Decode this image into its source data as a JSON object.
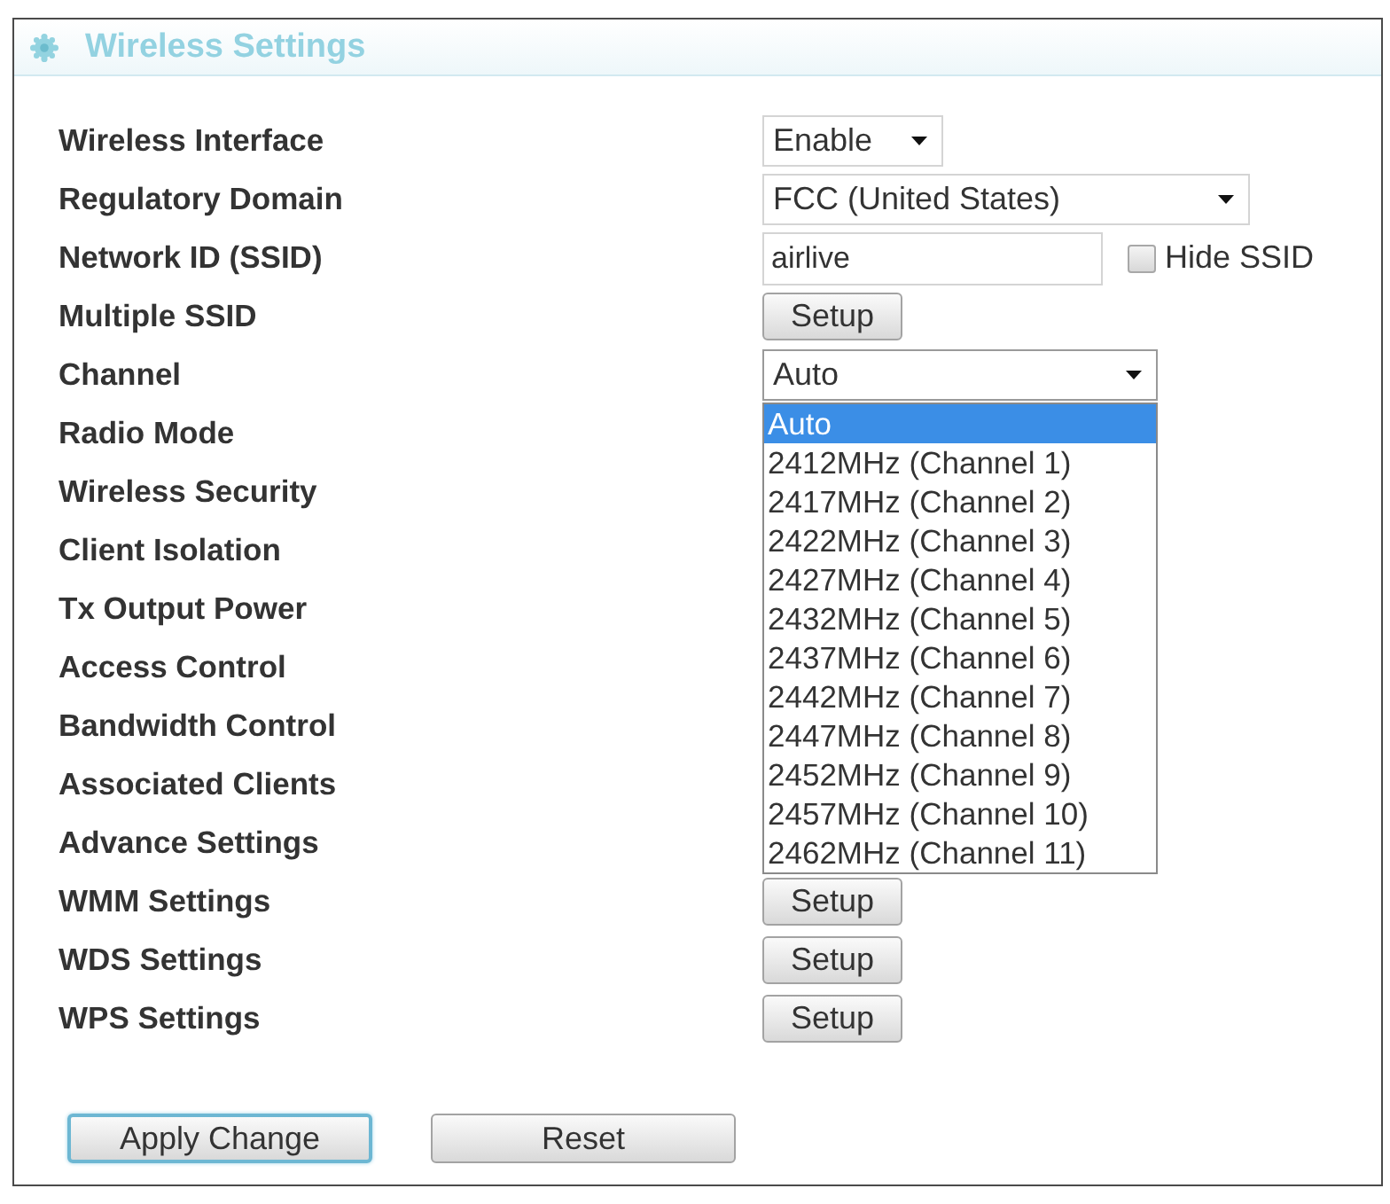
{
  "window": {
    "title": "Wireless Settings"
  },
  "rows": [
    {
      "label": "Wireless Interface",
      "kind": "select",
      "value": "Enable",
      "expanded": false
    },
    {
      "label": "Regulatory Domain",
      "kind": "select",
      "value": "FCC (United States)",
      "expanded": false
    },
    {
      "label": "Network ID (SSID)",
      "kind": "text",
      "value": "airlive",
      "checkbox": {
        "label": "Hide SSID",
        "checked": false
      }
    },
    {
      "label": "Multiple SSID",
      "kind": "button",
      "button": "Setup"
    },
    {
      "label": "Channel",
      "kind": "select",
      "value": "Auto",
      "expanded": true,
      "options": [
        {
          "label": "Auto",
          "selected": true
        },
        {
          "label": "2412MHz (Channel 1)",
          "selected": false
        },
        {
          "label": "2417MHz (Channel 2)",
          "selected": false
        },
        {
          "label": "2422MHz (Channel 3)",
          "selected": false
        },
        {
          "label": "2427MHz (Channel 4)",
          "selected": false
        },
        {
          "label": "2432MHz (Channel 5)",
          "selected": false
        },
        {
          "label": "2437MHz (Channel 6)",
          "selected": false
        },
        {
          "label": "2442MHz (Channel 7)",
          "selected": false
        },
        {
          "label": "2447MHz (Channel 8)",
          "selected": false
        },
        {
          "label": "2452MHz (Channel 9)",
          "selected": false
        },
        {
          "label": "2457MHz (Channel 10)",
          "selected": false
        },
        {
          "label": "2462MHz (Channel 11)",
          "selected": false
        }
      ]
    },
    {
      "label": "Radio Mode",
      "kind": "plain"
    },
    {
      "label": "Wireless Security",
      "kind": "plain"
    },
    {
      "label": "Client Isolation",
      "kind": "plain"
    },
    {
      "label": "Tx Output Power",
      "kind": "plain"
    },
    {
      "label": "Access Control",
      "kind": "plain"
    },
    {
      "label": "Bandwidth Control",
      "kind": "plain"
    },
    {
      "label": "Associated Clients",
      "kind": "plain"
    },
    {
      "label": "Advance Settings",
      "kind": "plain"
    },
    {
      "label": "WMM Settings",
      "kind": "button",
      "button": "Setup"
    },
    {
      "label": "WDS Settings",
      "kind": "button",
      "button": "Setup"
    },
    {
      "label": "WPS Settings",
      "kind": "button",
      "button": "Setup"
    }
  ],
  "buttons": [
    {
      "label": "Apply Change",
      "focused": true
    },
    {
      "label": "Reset",
      "focused": false
    }
  ]
}
